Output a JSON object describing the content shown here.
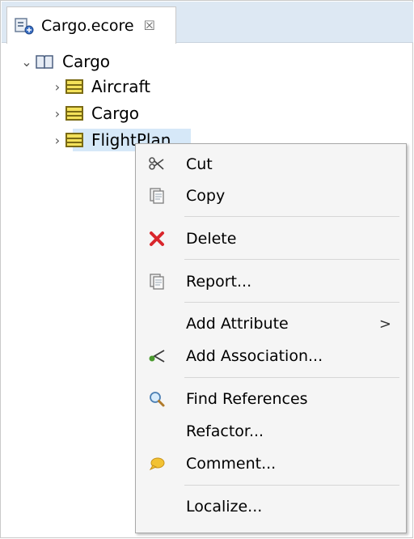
{
  "tab": {
    "title": "Cargo.ecore",
    "close_glyph": "☒",
    "icon": "ecore-model-icon"
  },
  "tree": {
    "root": {
      "label": "Cargo",
      "icon": "package-icon",
      "expanded": true
    },
    "children": [
      {
        "label": "Aircraft",
        "icon": "eclass-icon"
      },
      {
        "label": "Cargo",
        "icon": "eclass-icon"
      },
      {
        "label": "FlightPlan",
        "icon": "eclass-icon",
        "selected": true
      }
    ]
  },
  "menu": {
    "items": [
      {
        "label": "Cut",
        "icon": "scissors-icon"
      },
      {
        "label": "Copy",
        "icon": "copy-icon"
      },
      {
        "label": "Delete",
        "icon": "delete-x-icon"
      },
      {
        "label": "Report...",
        "icon": "report-icon"
      },
      {
        "label": "Add Attribute",
        "icon": "",
        "submenu_glyph": ">"
      },
      {
        "label": "Add Association...",
        "icon": "association-icon"
      },
      {
        "label": "Find References",
        "icon": "magnifier-icon"
      },
      {
        "label": "Refactor...",
        "icon": ""
      },
      {
        "label": "Comment...",
        "icon": "comment-bubble-icon"
      },
      {
        "label": "Localize...",
        "icon": ""
      }
    ]
  },
  "colors": {
    "tab_bar": "#dde8f3",
    "selection": "#d6e8f8",
    "menu_bg": "#f5f5f5",
    "class_icon_fill": "#f3e15a",
    "delete_red": "#d9262c"
  }
}
